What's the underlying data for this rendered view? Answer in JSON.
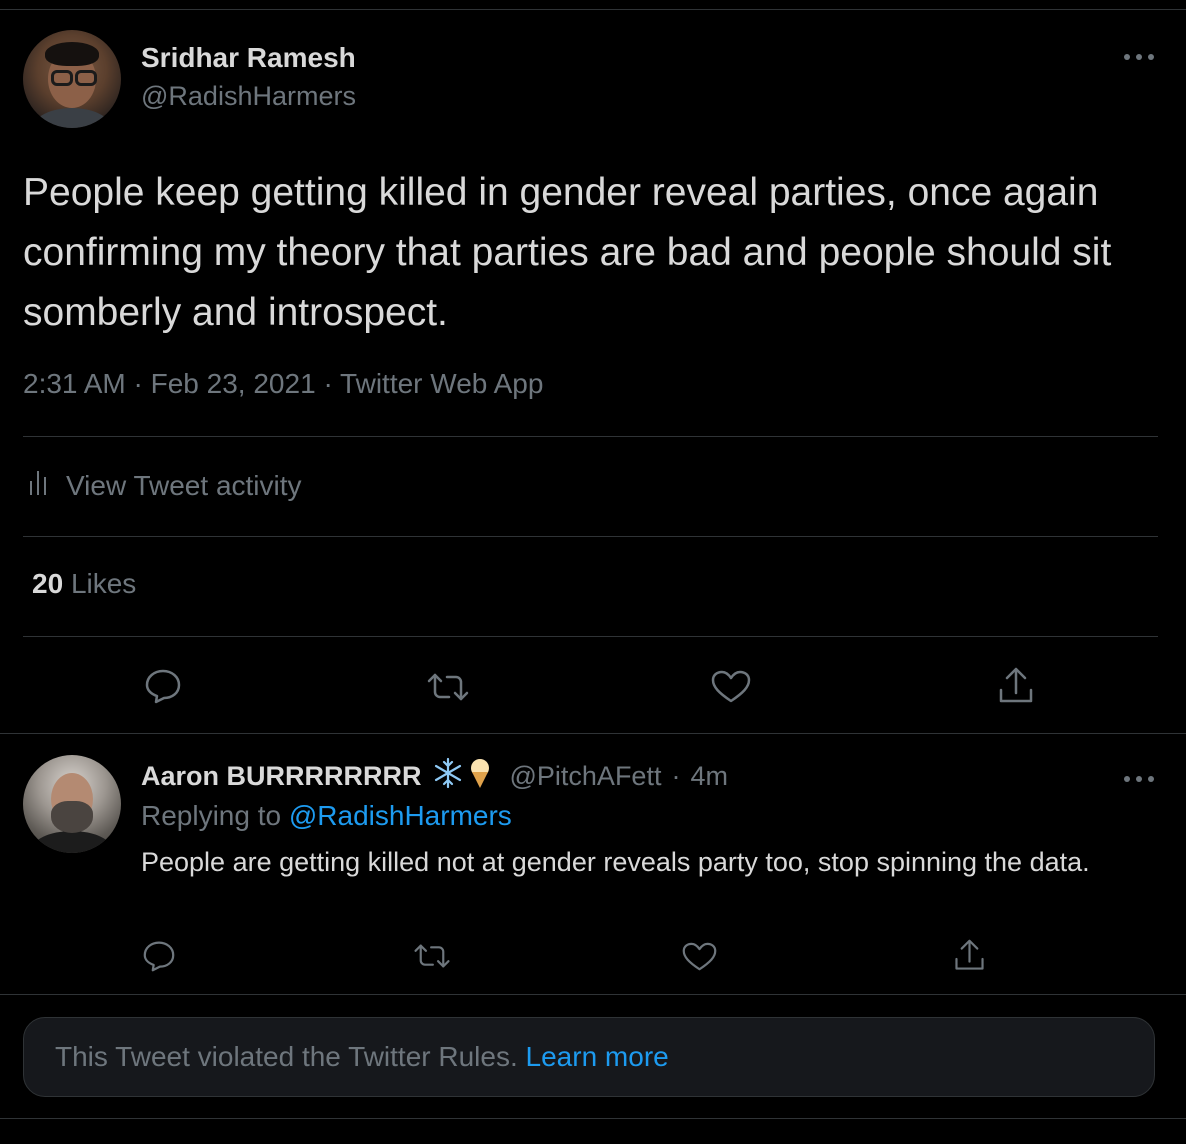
{
  "tweet": {
    "author_name": "Sridhar Ramesh",
    "author_handle": "@RadishHarmers",
    "text": "People keep getting killed in gender reveal parties, once again confirming my theory that parties are bad and people should sit somberly and introspect.",
    "time": "2:31 AM",
    "date": "Feb 23, 2021",
    "source": "Twitter Web App",
    "separator": "·",
    "activity_label": "View Tweet activity",
    "likes_count": "20",
    "likes_label": "Likes"
  },
  "reply": {
    "author_name": "Aaron BURRRRRRRR",
    "author_handle": "@PitchAFett",
    "separator": "·",
    "age": "4m",
    "replying_prefix": "Replying to",
    "replying_handle": "@RadishHarmers",
    "text": "People are getting killed not at gender reveals party too, stop spinning the data."
  },
  "violation_notice": {
    "text": "This Tweet violated the Twitter Rules.",
    "link": "Learn more"
  },
  "icons": {
    "more": "more-horizontal-icon",
    "activity": "bar-chart-icon",
    "reply": "reply-bubble-icon",
    "retweet": "retweet-icon",
    "like": "heart-icon",
    "share": "share-icon",
    "snowflake": "snowflake-icon",
    "ice_cream": "ice-cream-icon"
  },
  "colors": {
    "background": "#000000",
    "text": "#d9d9d9",
    "secondary": "#6e767d",
    "link": "#1d9bf0",
    "divider": "#2f3336"
  }
}
